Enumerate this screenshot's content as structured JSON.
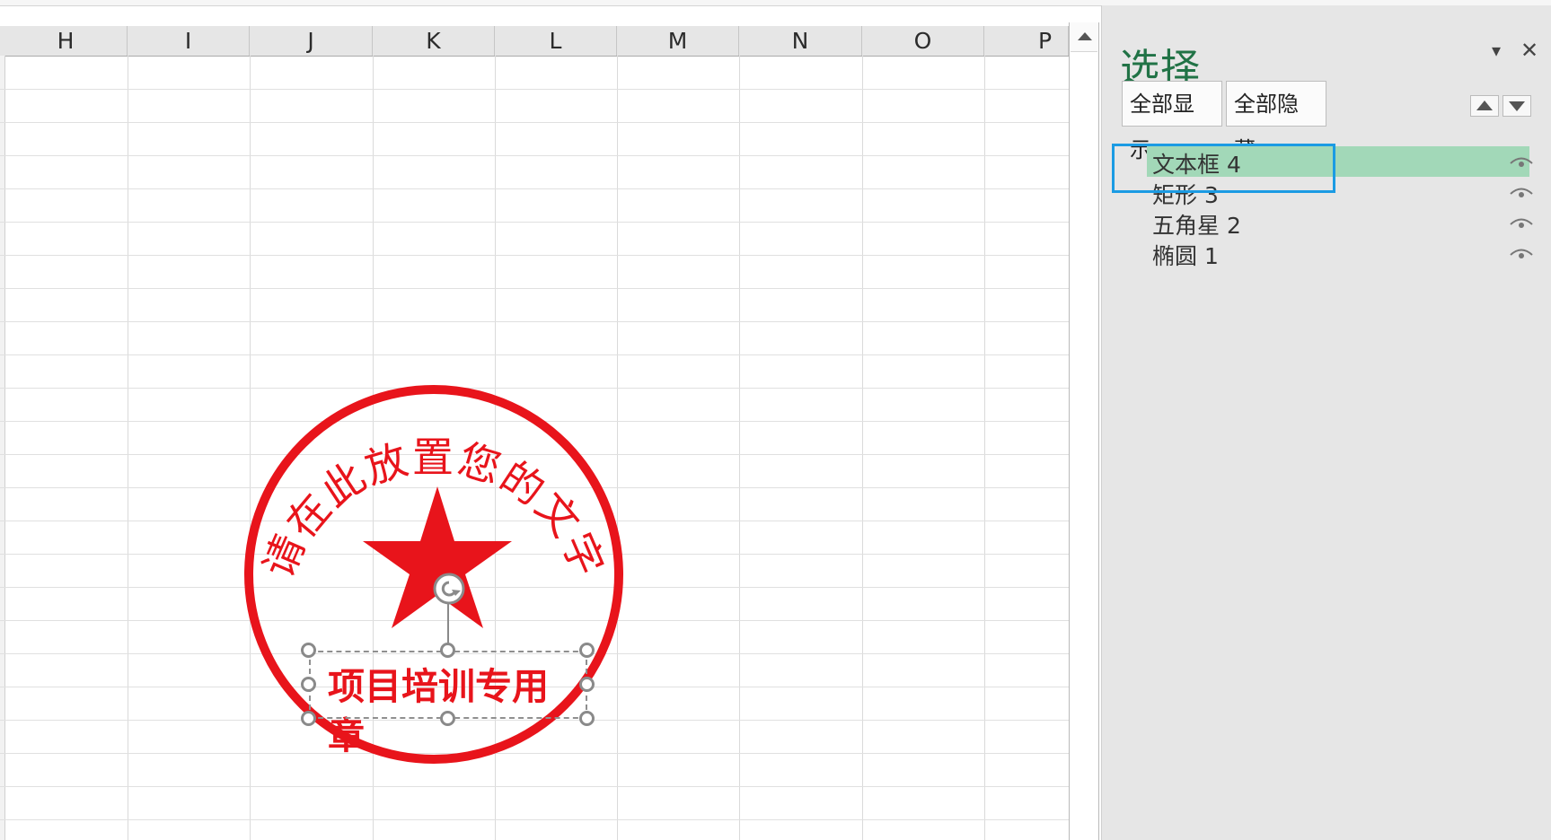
{
  "sheet": {
    "columns": [
      "H",
      "I",
      "J",
      "K",
      "L",
      "M",
      "N",
      "O",
      "P"
    ]
  },
  "seal": {
    "arc_text": "请在此放置您的文字",
    "star_color": "#e8141b",
    "ring_color": "#e8141b",
    "textbox_text": "项目培训专用",
    "textbox_overflow": "章"
  },
  "selection_pane": {
    "title": "选择",
    "dropdown_glyph": "▾",
    "close_glyph": "✕",
    "show_all": "全部显示",
    "hide_all": "全部隐藏",
    "items": [
      {
        "label": "文本框 4",
        "selected": true
      },
      {
        "label": "矩形 3",
        "selected": false
      },
      {
        "label": "五角星 2",
        "selected": false
      },
      {
        "label": "椭圆 1",
        "selected": false
      }
    ],
    "title_color": "#217346",
    "selected_bg": "#a2d8b8",
    "focus_color": "#1b9be3"
  }
}
